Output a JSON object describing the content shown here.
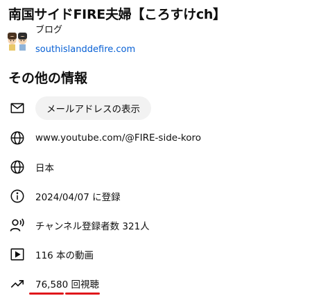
{
  "channel": {
    "title": "南国サイドFIRE夫婦【ころすけch】"
  },
  "links": {
    "item_label": "ブログ",
    "url": "southislanddefire.com"
  },
  "details": {
    "heading": "その他の情報",
    "email_button_label": "メールアドレスの表示",
    "channel_url": "www.youtube.com/@FIRE-side-koro",
    "country": "日本",
    "joined": "2024/04/07 に登録",
    "subscribers": "チャンネル登録者数 321人",
    "videos": "116 本の動画",
    "views": "76,580 回視聴"
  },
  "colors": {
    "link": "#065fd4",
    "button_bg": "#f2f2f2",
    "annotation_underline": "#e0161a"
  },
  "icons": [
    "avatar-illustration",
    "mail-icon",
    "globe-icon",
    "info-icon",
    "person-voice-icon",
    "video-icon",
    "trending-up-icon"
  ]
}
